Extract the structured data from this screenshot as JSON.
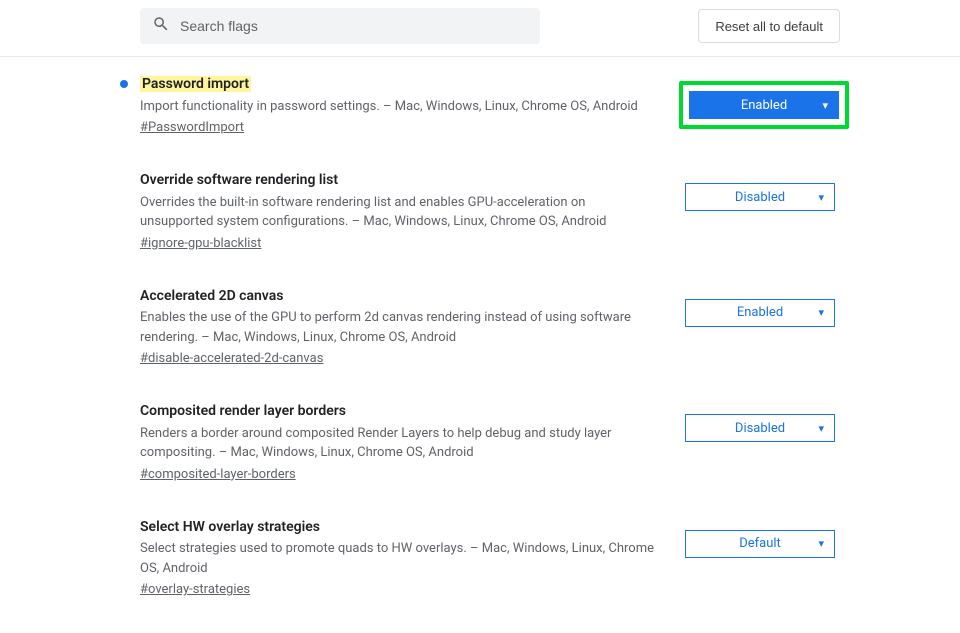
{
  "header": {
    "search_placeholder": "Search flags",
    "reset_label": "Reset all to default"
  },
  "flags": [
    {
      "title": "Password import",
      "desc": "Import functionality in password settings. – Mac, Windows, Linux, Chrome OS, Android",
      "anchor": "#PasswordImport",
      "value": "Enabled",
      "highlighted": true,
      "emphasized": true,
      "modified": true
    },
    {
      "title": "Override software rendering list",
      "desc": "Overrides the built-in software rendering list and enables GPU-acceleration on unsupported system configurations. – Mac, Windows, Linux, Chrome OS, Android",
      "anchor": "#ignore-gpu-blacklist",
      "value": "Disabled"
    },
    {
      "title": "Accelerated 2D canvas",
      "desc": "Enables the use of the GPU to perform 2d canvas rendering instead of using software rendering. – Mac, Windows, Linux, Chrome OS, Android",
      "anchor": "#disable-accelerated-2d-canvas",
      "value": "Enabled"
    },
    {
      "title": "Composited render layer borders",
      "desc": "Renders a border around composited Render Layers to help debug and study layer compositing. – Mac, Windows, Linux, Chrome OS, Android",
      "anchor": "#composited-layer-borders",
      "value": "Disabled"
    },
    {
      "title": "Select HW overlay strategies",
      "desc": "Select strategies used to promote quads to HW overlays. – Mac, Windows, Linux, Chrome OS, Android",
      "anchor": "#overlay-strategies",
      "value": "Default"
    }
  ]
}
